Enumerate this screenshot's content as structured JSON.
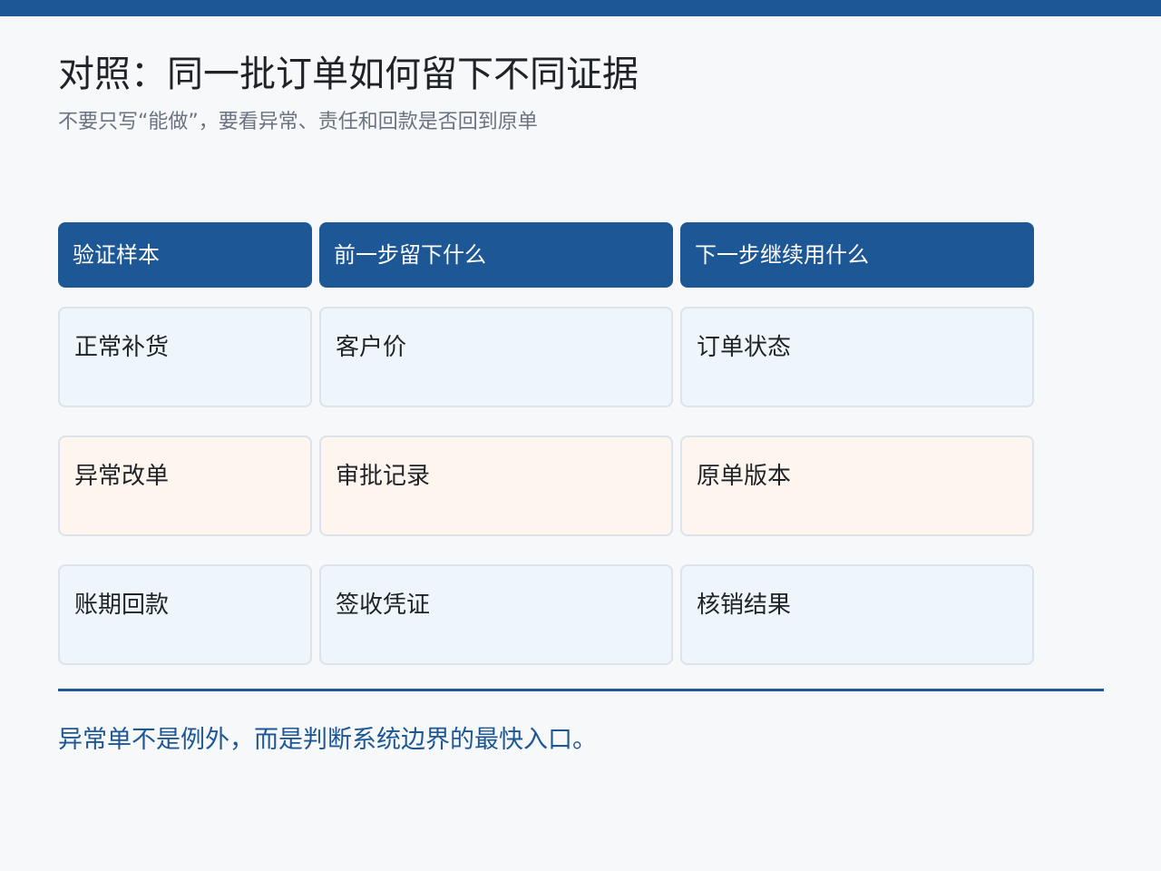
{
  "title": "对照：同一批订单如何留下不同证据",
  "subtitle": "不要只写“能做”，要看异常、责任和回款是否回到原单",
  "table": {
    "headers": [
      "验证样本",
      "前一步留下什么",
      "下一步继续用什么"
    ],
    "rows": [
      [
        "正常补货",
        "客户价",
        "订单状态"
      ],
      [
        "异常改单",
        "审批记录",
        "原单版本"
      ],
      [
        "账期回款",
        "签收凭证",
        "核销结果"
      ]
    ]
  },
  "conclusion": "异常单不是例外，而是判断系统边界的最快入口。",
  "colors": {
    "accent": "#1e5795",
    "row_blue": "#eef5fb",
    "row_peach": "#fdf5ee",
    "background": "#f6f8fa"
  }
}
